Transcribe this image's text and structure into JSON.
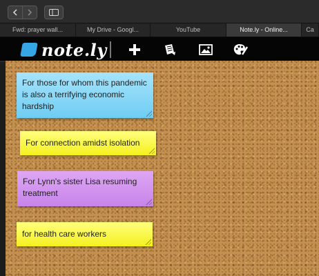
{
  "browser": {
    "tabs": [
      {
        "label": "Fwd: prayer wall...",
        "active": false
      },
      {
        "label": "My Drive - Googl...",
        "active": false
      },
      {
        "label": "YouTube",
        "active": false
      },
      {
        "label": "Note.ly - Online...",
        "active": true
      },
      {
        "label": "Ca",
        "active": false
      }
    ],
    "icons": [
      "back-icon",
      "forward-icon",
      "sidebar-icon"
    ]
  },
  "app": {
    "logo_text": "note.ly",
    "toolbar_icons": [
      "add-icon",
      "notes-icon",
      "image-icon",
      "palette-icon"
    ],
    "brand_color": "#35a6e6"
  },
  "notes": [
    {
      "text": "For those for whom this pandemic is also a terrifying economic hardship",
      "color": "#8ad8f7"
    },
    {
      "text": "For connection amidst isolation",
      "color": "#f8f54a"
    },
    {
      "text": "For Lynn's sister Lisa resuming treatment",
      "color": "#d296ef"
    },
    {
      "text": "for health care workers",
      "color": "#f8f54a"
    }
  ]
}
